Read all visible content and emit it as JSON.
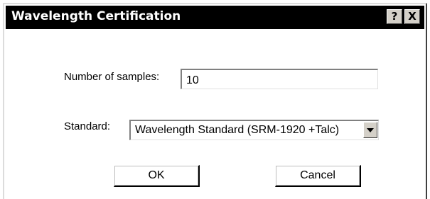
{
  "dialog": {
    "title": "Wavelength Certification",
    "help_label": "?",
    "close_label": "X"
  },
  "form": {
    "samples_label": "Number of samples:",
    "samples_value": "10",
    "standard_label": "Standard:",
    "standard_value": "Wavelength Standard (SRM-1920 +Talc)"
  },
  "buttons": {
    "ok_label": "OK",
    "cancel_label": "Cancel"
  },
  "colors": {
    "titlebar": "#000000",
    "title_text": "#ffffff",
    "face": "#d4d0c8"
  }
}
